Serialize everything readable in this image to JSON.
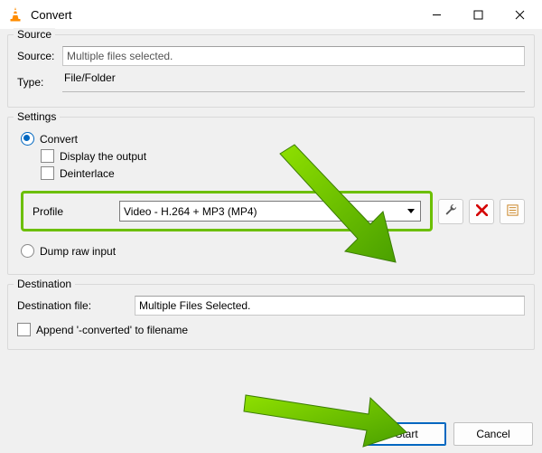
{
  "window": {
    "title": "Convert",
    "minimize_icon": "minimize",
    "maximize_icon": "maximize",
    "close_icon": "close"
  },
  "source": {
    "group_title": "Source",
    "source_label": "Source:",
    "source_value": "Multiple files selected.",
    "type_label": "Type:",
    "type_value": "File/Folder"
  },
  "settings": {
    "group_title": "Settings",
    "convert_label": "Convert",
    "display_output_label": "Display the output",
    "deinterlace_label": "Deinterlace",
    "profile_label": "Profile",
    "profile_value": "Video - H.264 + MP3 (MP4)",
    "edit_tooltip": "Edit selected profile",
    "delete_tooltip": "Delete selected profile",
    "new_tooltip": "Create a new profile",
    "dump_label": "Dump raw input"
  },
  "destination": {
    "group_title": "Destination",
    "file_label": "Destination file:",
    "file_value": "Multiple Files Selected.",
    "append_label": "Append '-converted' to filename"
  },
  "buttons": {
    "start": "Start",
    "cancel": "Cancel"
  }
}
